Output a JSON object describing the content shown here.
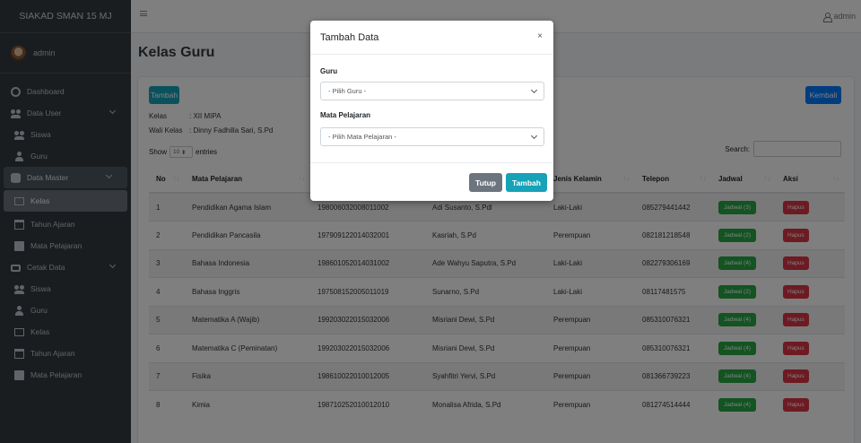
{
  "brand": "SIAKAD SMAN 15 MJ",
  "user": {
    "name": "admin"
  },
  "topbar": {
    "user_label": "admin"
  },
  "sidebar": {
    "items": [
      {
        "label": "Dashboard"
      },
      {
        "label": "Data User"
      },
      {
        "label": "Siswa"
      },
      {
        "label": "Guru"
      },
      {
        "label": "Data Master"
      },
      {
        "label": "Kelas"
      },
      {
        "label": "Tahun Ajaran"
      },
      {
        "label": "Mata Pelajaran"
      },
      {
        "label": "Cetak Data"
      },
      {
        "label": "Siswa"
      },
      {
        "label": "Guru"
      },
      {
        "label": "Kelas"
      },
      {
        "label": "Tahun Ajaran"
      },
      {
        "label": "Mata Pelajaran"
      }
    ]
  },
  "page": {
    "title": "Kelas Guru",
    "add_button": "Tambah",
    "back_button": "Kembali",
    "kelas_label": "Kelas",
    "kelas_value": ": XII MIPA",
    "wali_label": "Wali Kelas",
    "wali_value": ": Dinny Fadhilla Sari, S.Pd",
    "show_label": "Show",
    "show_value": "10",
    "entries_label": "entries",
    "search_label": "Search:"
  },
  "table": {
    "headers": [
      "No",
      "Mata Pelajaran",
      "",
      "",
      "Jenis Kelamin",
      "Telepon",
      "Jadwal",
      "Aksi"
    ],
    "rows": [
      {
        "no": "1",
        "mapel": "Pendidikan Agama Islam",
        "nip": "198006032008011002",
        "guru": "Adi Susanto, S.Pdl",
        "jk": "Laki-Laki",
        "telp": "085279441442",
        "jadwal": "Jadwal (3)",
        "aksi": "Hapus"
      },
      {
        "no": "2",
        "mapel": "Pendidikan Pancasila",
        "nip": "197909122014032001",
        "guru": "Kasriah, S.Pd",
        "jk": "Perempuan",
        "telp": "082181218548",
        "jadwal": "Jadwal (2)",
        "aksi": "Hapus"
      },
      {
        "no": "3",
        "mapel": "Bahasa Indonesia",
        "nip": "198601052014031002",
        "guru": "Ade Wahyu Saputra, S.Pd",
        "jk": "Laki-Laki",
        "telp": "082279306169",
        "jadwal": "Jadwal (4)",
        "aksi": "Hapus"
      },
      {
        "no": "4",
        "mapel": "Bahasa Inggris",
        "nip": "197508152005011019",
        "guru": "Sunarno, S.Pd",
        "jk": "Laki-Laki",
        "telp": "08117481575",
        "jadwal": "Jadwal (2)",
        "aksi": "Hapus"
      },
      {
        "no": "5",
        "mapel": "Matematika A (Wajib)",
        "nip": "199203022015032006",
        "guru": "Misriani Dewi, S.Pd",
        "jk": "Perempuan",
        "telp": "085310076321",
        "jadwal": "Jadwal (4)",
        "aksi": "Hapus"
      },
      {
        "no": "6",
        "mapel": "Matematika C (Peminatan)",
        "nip": "199203022015032006",
        "guru": "Misriani Dewi, S.Pd",
        "jk": "Perempuan",
        "telp": "085310076321",
        "jadwal": "Jadwal (4)",
        "aksi": "Hapus"
      },
      {
        "no": "7",
        "mapel": "Fisika",
        "nip": "198610022010012005",
        "guru": "Syahfitri Yervi, S.Pd",
        "jk": "Perempuan",
        "telp": "081366739223",
        "jadwal": "Jadwal (4)",
        "aksi": "Hapus"
      },
      {
        "no": "8",
        "mapel": "Kimia",
        "nip": "198710252010012010",
        "guru": "Monalisa Afrida, S.Pd",
        "jk": "Perempuan",
        "telp": "081274514444",
        "jadwal": "Jadwal (4)",
        "aksi": "Hapus"
      }
    ]
  },
  "modal": {
    "title": "Tambah Data",
    "close": "×",
    "guru_label": "Guru",
    "guru_placeholder": "- Pilih Guru -",
    "mapel_label": "Mata Pelajaran",
    "mapel_placeholder": "- Pilih Mata Pelajaran -",
    "cancel_button": "Tutup",
    "submit_button": "Tambah"
  },
  "colors": {
    "sidebar_bg": "#343a40",
    "primary": "#007bff",
    "info": "#17a2b8",
    "success": "#28a745",
    "danger": "#dc3545",
    "secondary": "#6c757d"
  }
}
